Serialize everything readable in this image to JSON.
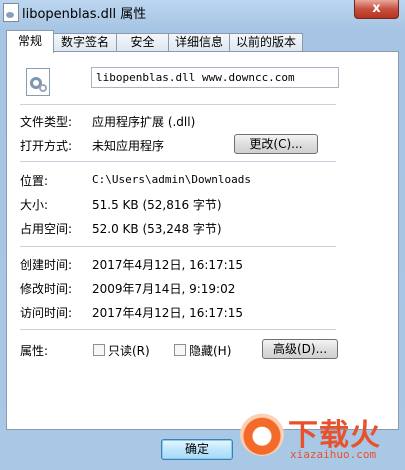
{
  "window": {
    "title": "libopenblas.dll 属性",
    "close_label": "x"
  },
  "tabs": [
    {
      "label": "常规",
      "active": true
    },
    {
      "label": "数字签名",
      "active": false
    },
    {
      "label": "安全",
      "active": false
    },
    {
      "label": "详细信息",
      "active": false
    },
    {
      "label": "以前的版本",
      "active": false
    }
  ],
  "general": {
    "file_name": "libopenblas.dll www.downcc.com",
    "file_type": {
      "label": "文件类型:",
      "value": "应用程序扩展 (.dll)"
    },
    "opens_with": {
      "label": "打开方式:",
      "value": "未知应用程序",
      "change_button": "更改(C)..."
    },
    "location": {
      "label": "位置:",
      "value": "C:\\Users\\admin\\Downloads"
    },
    "size": {
      "label": "大小:",
      "value": "51.5 KB (52,816 字节)"
    },
    "size_on_disk": {
      "label": "占用空间:",
      "value": "52.0 KB (53,248 字节)"
    },
    "created": {
      "label": "创建时间:",
      "value": "2017年4月12日, 16:17:15"
    },
    "modified": {
      "label": "修改时间:",
      "value": "2009年7月14日, 9:19:02"
    },
    "accessed": {
      "label": "访问时间:",
      "value": "2017年4月12日, 16:17:15"
    },
    "attributes": {
      "label": "属性:",
      "readonly": {
        "label": "只读(R)",
        "checked": false
      },
      "hidden": {
        "label": "隐藏(H)",
        "checked": false
      },
      "advanced_button": "高级(D)..."
    }
  },
  "footer": {
    "ok_button": "确定"
  },
  "watermark": {
    "brand": "下载火",
    "site": "xiazaihuo.com"
  }
}
